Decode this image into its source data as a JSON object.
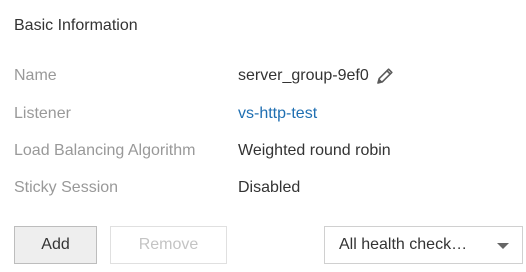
{
  "section": {
    "title": "Basic Information"
  },
  "fields": [
    {
      "label": "Name",
      "value": "server_group-9ef0"
    },
    {
      "label": "Listener",
      "value": "vs-http-test"
    },
    {
      "label": "Load Balancing Algorithm",
      "value": "Weighted round robin"
    },
    {
      "label": "Sticky Session",
      "value": "Disabled"
    }
  ],
  "actions": {
    "add_label": "Add",
    "remove_label": "Remove"
  },
  "filter": {
    "selected": "All health check…"
  },
  "colors": {
    "link": "#1f6fb2",
    "label": "#999999",
    "text": "#333333"
  },
  "icons": {
    "edit": "pencil-icon",
    "dropdown": "caret-down-icon"
  }
}
